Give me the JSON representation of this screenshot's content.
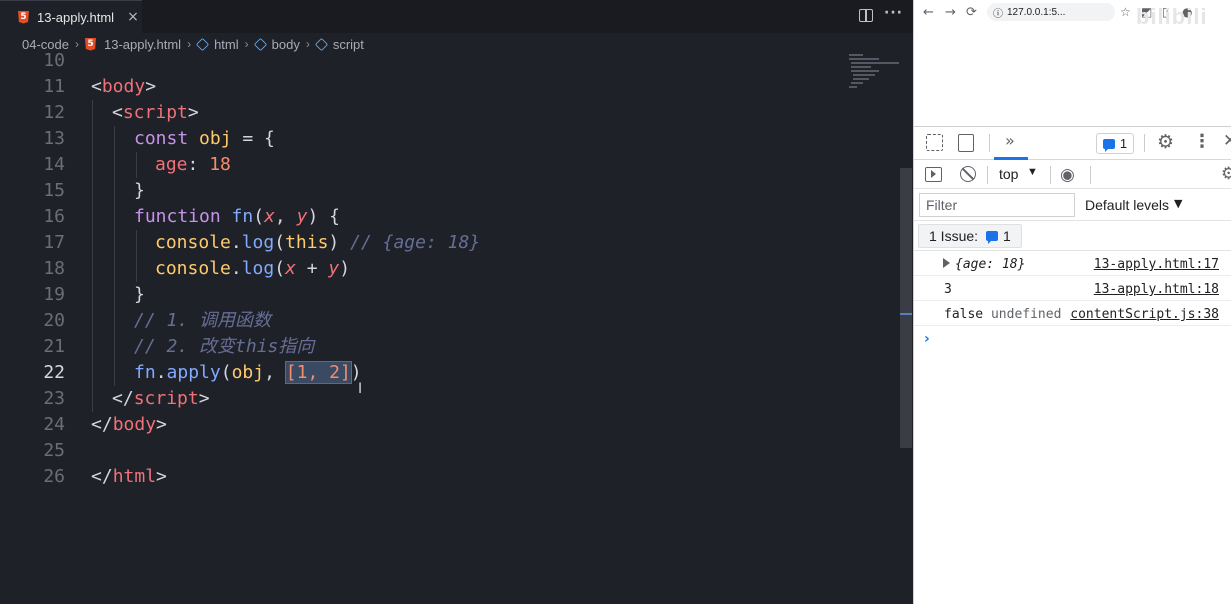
{
  "editor": {
    "tab": {
      "filename": "13-apply.html",
      "icon": "html5-icon",
      "close": "×"
    },
    "actions": {
      "split": "split-editor-icon",
      "more": "···"
    },
    "breadcrumb": {
      "folder": "04-code",
      "file": "13-apply.html",
      "html": "html",
      "body": "body",
      "script": "script",
      "separator": "›"
    },
    "active_line": "22",
    "lines": [
      {
        "n": "10",
        "parts": []
      },
      {
        "n": "11",
        "parts": [
          "<",
          "body",
          ">"
        ]
      },
      {
        "n": "12",
        "parts": [
          "<",
          "script",
          ">"
        ]
      },
      {
        "n": "13",
        "parts": [
          "const",
          " ",
          "obj",
          " = {"
        ]
      },
      {
        "n": "14",
        "parts": [
          "age",
          ": ",
          "18"
        ]
      },
      {
        "n": "15",
        "parts": [
          "}"
        ]
      },
      {
        "n": "16",
        "parts": [
          "function",
          " ",
          "fn",
          "(",
          "x",
          ", ",
          "y",
          ") {"
        ]
      },
      {
        "n": "17",
        "parts": [
          "console",
          ".",
          "log",
          "(",
          "this",
          ") ",
          "// {age: 18}"
        ]
      },
      {
        "n": "18",
        "parts": [
          "console",
          ".",
          "log",
          "(",
          "x",
          " + ",
          "y",
          ")"
        ]
      },
      {
        "n": "19",
        "parts": [
          "}"
        ]
      },
      {
        "n": "20",
        "parts": [
          "// 1. 调用函数"
        ]
      },
      {
        "n": "21",
        "parts": [
          "// 2. 改变this指向"
        ]
      },
      {
        "n": "22",
        "parts": [
          "fn",
          ".",
          "apply",
          "(",
          "obj",
          ", ",
          "[1, 2]",
          ")"
        ]
      },
      {
        "n": "23",
        "parts": [
          "</",
          "script",
          ">"
        ]
      },
      {
        "n": "24",
        "parts": [
          "</",
          "body",
          ">"
        ]
      },
      {
        "n": "25",
        "parts": []
      },
      {
        "n": "26",
        "parts": [
          "</",
          "html",
          ">"
        ]
      }
    ]
  },
  "browser": {
    "nav": {
      "back": "←",
      "forward": "→",
      "reload": "⟳"
    },
    "url": "127.0.0.1:5...",
    "watermark": "bilibili",
    "devtools": {
      "more_panels": "»",
      "issues_count": "1",
      "console_context": "top",
      "filter_placeholder": "Filter",
      "levels_label": "Default levels",
      "issues_label": "1 Issue:",
      "issues_badge_count": "1",
      "log": [
        {
          "message": "{age: 18}",
          "source": "13-apply.html:17"
        },
        {
          "message": "3",
          "source": "13-apply.html:18"
        },
        {
          "message_a": "false",
          "message_b": "undefined",
          "source": "contentScript.js:38"
        }
      ],
      "prompt": "›"
    }
  },
  "colors": {
    "editor_bg": "#1f2128",
    "tag": "#f07178",
    "keyword": "#c792ea",
    "function": "#82aaff",
    "number": "#f78c6c",
    "comment": "#676e95",
    "devtools_accent": "#1a73e8"
  }
}
